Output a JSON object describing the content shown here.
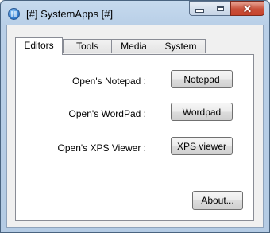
{
  "window": {
    "title": "[#] SystemApps [#]",
    "close_glyph": "✕"
  },
  "tabs": [
    {
      "label": "Editors",
      "active": true
    },
    {
      "label": "Tools",
      "active": false
    },
    {
      "label": "Media",
      "active": false
    },
    {
      "label": "System",
      "active": false
    }
  ],
  "editors": {
    "rows": [
      {
        "label": "Open's Notepad :",
        "button": "Notepad"
      },
      {
        "label": "Open's WordPad :",
        "button": "Wordpad"
      },
      {
        "label": "Open's XPS Viewer :",
        "button": "XPS viewer"
      }
    ],
    "about_button": "About..."
  },
  "colors": {
    "title_bar": "#b9cfe7",
    "close_button": "#c7432b",
    "panel_background": "#f0f0f0"
  },
  "icons": {
    "app": "app-icon",
    "minimize": "minimize-icon",
    "maximize": "maximize-icon",
    "close": "close-icon"
  }
}
